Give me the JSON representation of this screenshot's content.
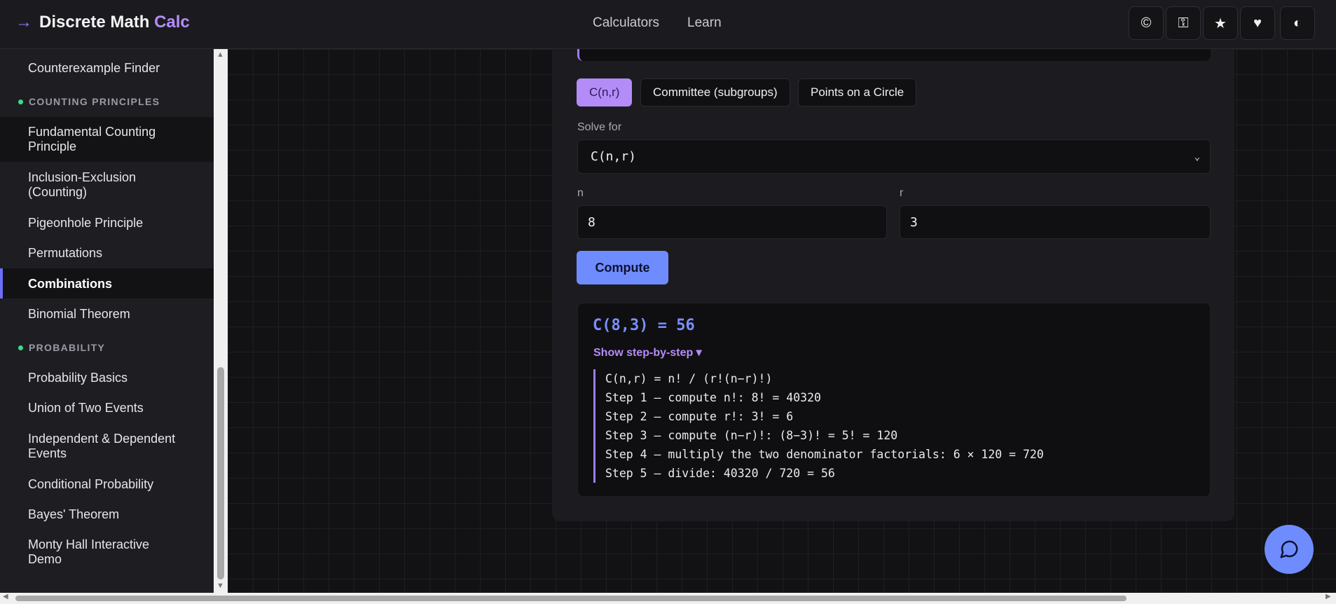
{
  "header": {
    "brand_arrow": "→",
    "brand_main": "Discrete Math",
    "brand_accent": "Calc",
    "nav": [
      "Calculators",
      "Learn"
    ],
    "icons": [
      {
        "name": "copyright-icon",
        "glyph": "©"
      },
      {
        "name": "key-icon",
        "glyph": "⚿"
      },
      {
        "name": "star-icon",
        "glyph": "★"
      },
      {
        "name": "heart-icon",
        "glyph": "♥"
      },
      {
        "name": "theme-toggle-icon",
        "glyph": "◐"
      }
    ]
  },
  "sidebar": {
    "items": [
      {
        "label": "Counterexample Finder"
      },
      {
        "section": "COUNTING PRINCIPLES"
      },
      {
        "label": "Fundamental Counting Principle"
      },
      {
        "label": "Inclusion-Exclusion (Counting)"
      },
      {
        "label": "Pigeonhole Principle"
      },
      {
        "label": "Permutations"
      },
      {
        "label": "Combinations"
      },
      {
        "label": "Binomial Theorem"
      },
      {
        "section": "PROBABILITY"
      },
      {
        "label": "Probability Basics"
      },
      {
        "label": "Union of Two Events"
      },
      {
        "label": "Independent & Dependent Events"
      },
      {
        "label": "Conditional Probability"
      },
      {
        "label": "Bayes' Theorem"
      },
      {
        "label": "Monty Hall Interactive Demo"
      }
    ],
    "active_label": "Combinations"
  },
  "calculator": {
    "presets": [
      "C(n,r)",
      "Committee (subgroups)",
      "Points on a Circle"
    ],
    "selected_preset": "C(n,r)",
    "solve_for_label": "Solve for",
    "solve_for_value": "C(n,r)",
    "n_label": "n",
    "n_value": "8",
    "r_label": "r",
    "r_value": "3",
    "compute_label": "Compute",
    "result_title": "C(8,3) = 56",
    "show_steps_label": "Show step-by-step ▾",
    "steps": [
      "C(n,r) = n! / (r!(n−r)!)",
      "Step 1 — compute n!: 8! = 40320",
      "Step 2 — compute r!: 3! = 6",
      "Step 3 — compute (n−r)!: (8−3)! = 5! = 120",
      "Step 4 — multiply the two denominator factorials: 6 × 120 = 720",
      "Step 5 — divide: 40320 / 720 = 56"
    ]
  },
  "colors": {
    "accent": "#b58cff",
    "primary": "#6f8cff",
    "section_dot": "#3ddc84"
  }
}
